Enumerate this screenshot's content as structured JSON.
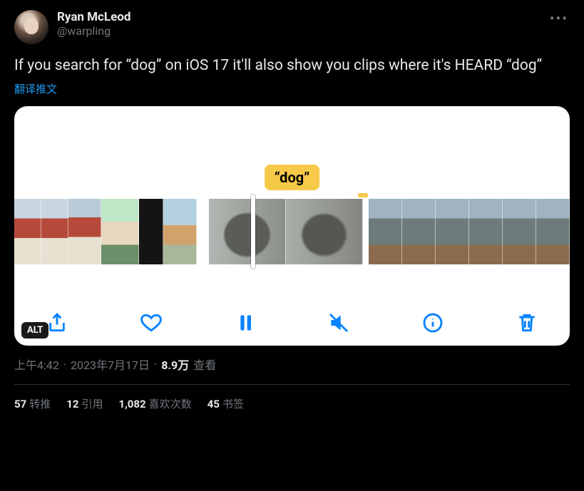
{
  "author": {
    "display_name": "Ryan McLeod",
    "handle": "@warpling"
  },
  "tweet": {
    "text": "If you search for “dog” on iOS 17 it'll also show you clips where it's HEARD “dog”",
    "translate_label": "翻译推文"
  },
  "media": {
    "search_term": "“dog”",
    "alt_badge": "ALT"
  },
  "meta": {
    "time": "上午4:42",
    "sep1": " · ",
    "date": "2023年7月17日",
    "sep2": " · ",
    "views_count": "8.9万",
    "views_label": " 查看"
  },
  "stats": {
    "retweets_count": "57",
    "retweets_label": "转推",
    "quotes_count": "12",
    "quotes_label": "引用",
    "likes_count": "1,082",
    "likes_label": "喜欢次数",
    "bookmarks_count": "45",
    "bookmarks_label": "书签"
  }
}
